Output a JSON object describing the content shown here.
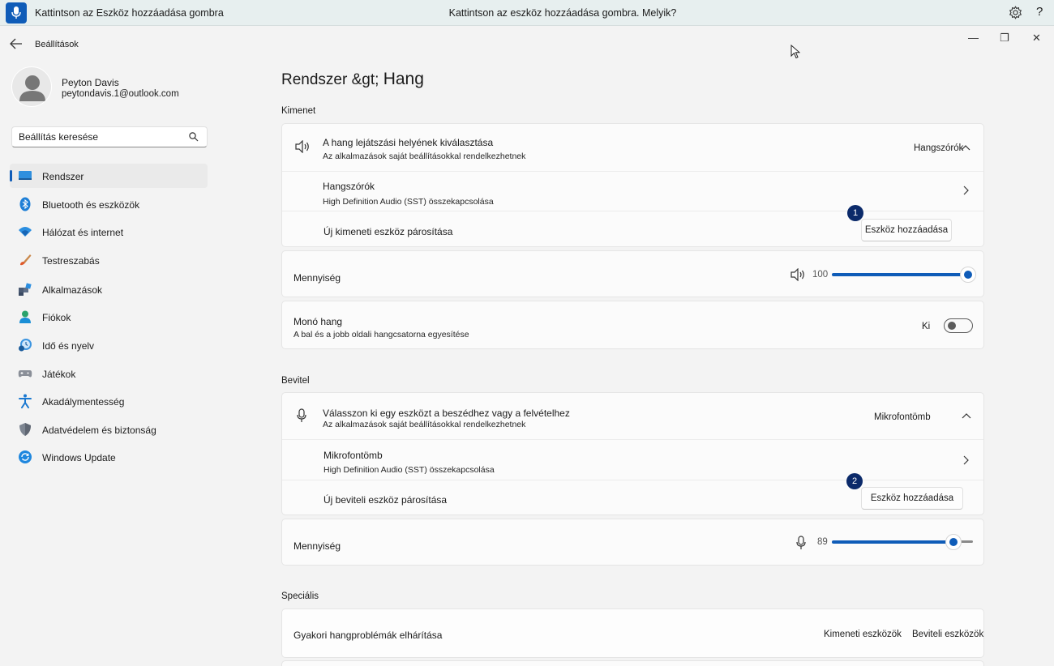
{
  "voice_bar": {
    "hint": "Kattintson az Eszköz hozzáadása gombra",
    "prompt": "Kattintson az eszköz hozzáadása gombra. Melyik?",
    "help": "?"
  },
  "window": {
    "title": "Beállítások",
    "min": "—",
    "restore": "❐",
    "close": "✕"
  },
  "user": {
    "name": "Peyton Davis",
    "email": "peytondavis.1@outlook.com"
  },
  "search": {
    "placeholder": "Beállítás keresése"
  },
  "nav": [
    {
      "label": "Rendszer",
      "icon": "system-icon"
    },
    {
      "label": "Bluetooth és eszközök",
      "icon": "bluetooth-icon"
    },
    {
      "label": "Hálózat és internet",
      "icon": "network-icon"
    },
    {
      "label": "Testreszabás",
      "icon": "personalization-icon"
    },
    {
      "label": "Alkalmazások",
      "icon": "apps-icon"
    },
    {
      "label": "Fiókok",
      "icon": "accounts-icon"
    },
    {
      "label": "Idő és nyelv",
      "icon": "time-language-icon"
    },
    {
      "label": "Játékok",
      "icon": "gaming-icon"
    },
    {
      "label": "Akadálymentesség",
      "icon": "accessibility-icon"
    },
    {
      "label": "Adatvédelem és biztonság",
      "icon": "privacy-icon"
    },
    {
      "label": "Windows Update",
      "icon": "windows-update-icon"
    }
  ],
  "breadcrumb": {
    "parent": "Rendszer &gt;",
    "current": "Hang"
  },
  "output": {
    "heading": "Kimenet",
    "choose_title": "A hang lejátszási helyének kiválasztása",
    "choose_sub": "Az alkalmazások saját beállításokkal rendelkezhetnek",
    "selected": "Hangszórók",
    "device_name": "Hangszórók",
    "device_desc": "High Definition Audio (SST) összekapcsolása",
    "pair_label": "Új kimeneti eszköz párosítása",
    "add_button": "Eszköz hozzáadása",
    "badge": "1",
    "volume_label": "Mennyiség",
    "volume_value": "100",
    "volume_level": 1.0,
    "mono_title": "Monó hang",
    "mono_sub": "A bal és a jobb oldali hangcsatorna egyesítése",
    "mono_state": "Ki"
  },
  "input": {
    "heading": "Bevitel",
    "choose_title": "Válasszon ki egy eszközt a beszédhez vagy a felvételhez",
    "choose_sub": "Az alkalmazások saját beállításokkal rendelkezhetnek",
    "selected": "Mikrofontömb",
    "device_name": "Mikrofontömb",
    "device_desc": "High Definition Audio (SST) összekapcsolása",
    "pair_label": "Új beviteli eszköz párosítása",
    "add_button": "Eszköz hozzáadása",
    "badge": "2",
    "volume_label": "Mennyiség",
    "volume_value": "89",
    "volume_level": 0.89
  },
  "advanced": {
    "heading": "Speciális",
    "troubleshoot": "Gyakori hangproblémák elhárítása",
    "output_devices": "Kimeneti eszközök",
    "input_devices": "Beviteli eszközök"
  }
}
